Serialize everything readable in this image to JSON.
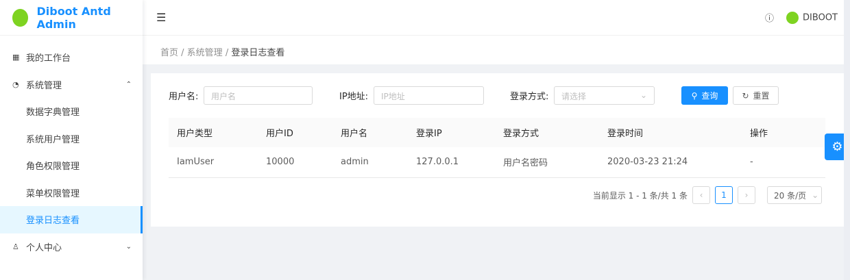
{
  "app": {
    "title": "Diboot Antd Admin"
  },
  "sidebar": {
    "items": [
      {
        "label": "我的工作台",
        "icon": "dashboard-icon"
      },
      {
        "label": "系统管理",
        "icon": "gauge-icon",
        "expanded": true,
        "children": [
          {
            "label": "数据字典管理"
          },
          {
            "label": "系统用户管理"
          },
          {
            "label": "角色权限管理"
          },
          {
            "label": "菜单权限管理"
          },
          {
            "label": "登录日志查看",
            "active": true
          }
        ]
      },
      {
        "label": "个人中心",
        "icon": "user-icon"
      }
    ]
  },
  "header": {
    "user": "DIBOOT"
  },
  "breadcrumb": [
    "首页",
    "系统管理",
    "登录日志查看"
  ],
  "form": {
    "username_label": "用户名:",
    "username_placeholder": "用户名",
    "ip_label": "IP地址:",
    "ip_placeholder": "IP地址",
    "method_label": "登录方式:",
    "method_placeholder": "请选择",
    "search": "查询",
    "reset": "重置"
  },
  "table": {
    "columns": [
      "用户类型",
      "用户ID",
      "用户名",
      "登录IP",
      "登录方式",
      "登录时间",
      "操作"
    ],
    "rows": [
      [
        "IamUser",
        "10000",
        "admin",
        "127.0.0.1",
        "用户名密码",
        "2020-03-23 21:24",
        "-"
      ]
    ]
  },
  "pagination": {
    "summary": "当前显示 1 - 1 条/共 1 条",
    "current": "1",
    "page_size": "20 条/页"
  },
  "colors": {
    "primary": "#1890ff",
    "logo": "#7ed321"
  }
}
